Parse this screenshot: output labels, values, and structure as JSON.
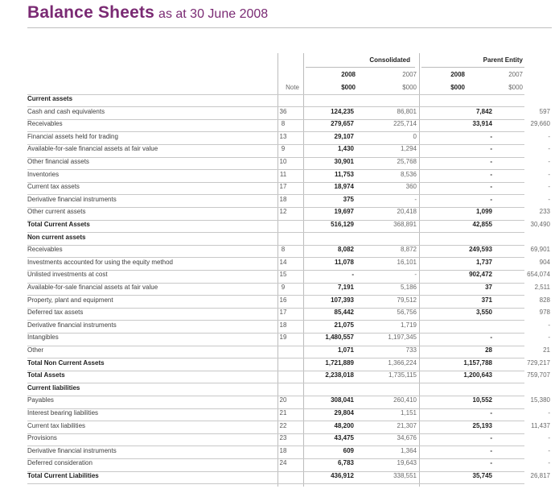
{
  "title": {
    "main": "Balance Sheets",
    "sub": "as at 30 June 2008"
  },
  "header": {
    "consolidated": "Consolidated",
    "parent": "Parent Entity",
    "years": [
      "2008",
      "2007",
      "2008",
      "2007"
    ],
    "units": [
      "$000",
      "$000",
      "$000",
      "$000"
    ],
    "note": "Note"
  },
  "rows": [
    {
      "label": "Current assets",
      "type": "section"
    },
    {
      "label": "Cash and cash equivalents",
      "note": "36",
      "v": [
        "124,235",
        "86,801",
        "7,842",
        "597"
      ]
    },
    {
      "label": "Receivables",
      "note": "8",
      "v": [
        "279,657",
        "225,714",
        "33,914",
        "29,660"
      ]
    },
    {
      "label": "Financial assets held for trading",
      "note": "13",
      "v": [
        "29,107",
        "0",
        "-",
        "-"
      ]
    },
    {
      "label": "Available-for-sale financial assets at fair value",
      "note": "9",
      "v": [
        "1,430",
        "1,294",
        "-",
        "-"
      ]
    },
    {
      "label": "Other financial assets",
      "note": "10",
      "v": [
        "30,901",
        "25,768",
        "-",
        "-"
      ]
    },
    {
      "label": "Inventories",
      "note": "11",
      "v": [
        "11,753",
        "8,536",
        "-",
        "-"
      ]
    },
    {
      "label": "Current tax assets",
      "note": "17",
      "v": [
        "18,974",
        "360",
        "-",
        "-"
      ]
    },
    {
      "label": "Derivative financial instruments",
      "note": "18",
      "v": [
        "375",
        "-",
        "-",
        "-"
      ]
    },
    {
      "label": "Other current assets",
      "note": "12",
      "v": [
        "19,697",
        "20,418",
        "1,099",
        "233"
      ]
    },
    {
      "label": "Total Current Assets",
      "type": "total",
      "v": [
        "516,129",
        "368,891",
        "42,855",
        "30,490"
      ]
    },
    {
      "label": "Non current assets",
      "type": "section"
    },
    {
      "label": "Receivables",
      "note": "8",
      "v": [
        "8,082",
        "8,872",
        "249,593",
        "69,901"
      ]
    },
    {
      "label": "Investments accounted for using the equity method",
      "note": "14",
      "v": [
        "11,078",
        "16,101",
        "1,737",
        "904"
      ]
    },
    {
      "label": "Unlisted investments at cost",
      "note": "15",
      "v": [
        "-",
        "-",
        "902,472",
        "654,074"
      ]
    },
    {
      "label": "Available-for-sale financial assets at fair value",
      "note": "9",
      "v": [
        "7,191",
        "5,186",
        "37",
        "2,511"
      ]
    },
    {
      "label": "Property, plant and equipment",
      "note": "16",
      "v": [
        "107,393",
        "79,512",
        "371",
        "828"
      ]
    },
    {
      "label": "Deferred tax assets",
      "note": "17",
      "v": [
        "85,442",
        "56,756",
        "3,550",
        "978"
      ]
    },
    {
      "label": "Derivative financial instruments",
      "note": "18",
      "v": [
        "21,075",
        "1,719",
        "",
        "-"
      ]
    },
    {
      "label": "Intangibles",
      "note": "19",
      "v": [
        "1,480,557",
        "1,197,345",
        "-",
        "-"
      ]
    },
    {
      "label": "Other",
      "note": "",
      "v": [
        "1,071",
        "733",
        "28",
        "21"
      ]
    },
    {
      "label": "Total Non Current Assets",
      "type": "total",
      "v": [
        "1,721,889",
        "1,366,224",
        "1,157,788",
        "729,217"
      ]
    },
    {
      "label": "Total Assets",
      "type": "total",
      "v": [
        "2,238,018",
        "1,735,115",
        "1,200,643",
        "759,707"
      ]
    },
    {
      "label": "Current liabilities",
      "type": "section"
    },
    {
      "label": "Payables",
      "note": "20",
      "v": [
        "308,041",
        "260,410",
        "10,552",
        "15,380"
      ]
    },
    {
      "label": "Interest bearing liabilities",
      "note": "21",
      "v": [
        "29,804",
        "1,151",
        "-",
        "-"
      ]
    },
    {
      "label": "Current tax liabilities",
      "note": "22",
      "v": [
        "48,200",
        "21,307",
        "25,193",
        "11,437"
      ]
    },
    {
      "label": "Provisions",
      "note": "23",
      "v": [
        "43,475",
        "34,676",
        "-",
        "-"
      ]
    },
    {
      "label": "Derivative financial instruments",
      "note": "18",
      "v": [
        "609",
        "1,364",
        "-",
        "-"
      ]
    },
    {
      "label": "Deferred consideration",
      "note": "24",
      "v": [
        "6,783",
        "19,643",
        "-",
        "-"
      ]
    },
    {
      "label": "Total Current Liabilities",
      "type": "total",
      "v": [
        "436,912",
        "338,551",
        "35,745",
        "26,817"
      ]
    }
  ]
}
